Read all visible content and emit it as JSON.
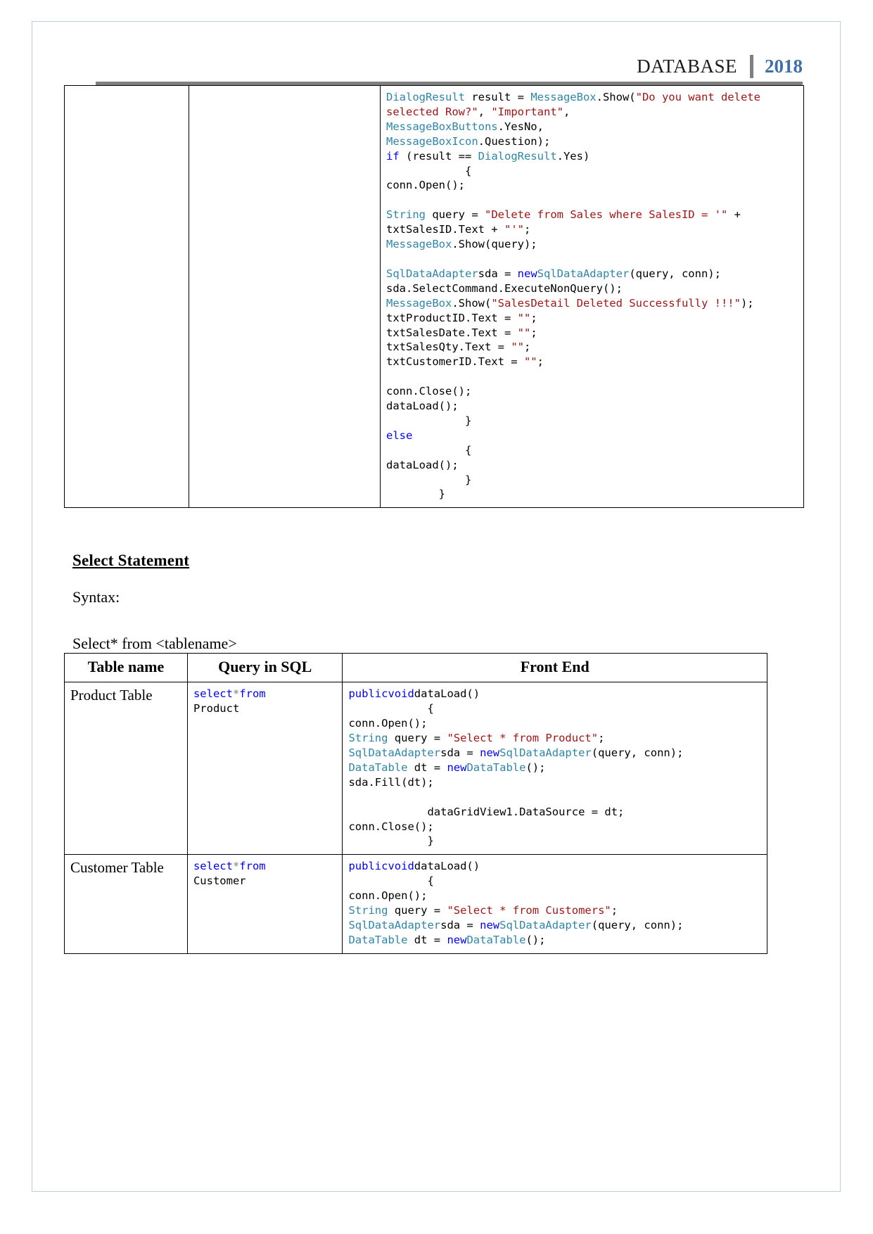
{
  "header": {
    "title": "DATABASE",
    "year": "2018"
  },
  "top_table": {
    "cells": {
      "col1": "",
      "col2": "",
      "code_segments": [
        {
          "t": "DialogResult",
          "c": "type"
        },
        {
          "t": " result = ",
          "c": ""
        },
        {
          "t": "MessageBox",
          "c": "type"
        },
        {
          "t": ".Show(",
          "c": ""
        },
        {
          "t": "\"Do you want delete selected Row?\"",
          "c": "str"
        },
        {
          "t": ", ",
          "c": ""
        },
        {
          "t": "\"Important\"",
          "c": "str"
        },
        {
          "t": ", \n",
          "c": ""
        },
        {
          "t": "MessageBoxButtons",
          "c": "type"
        },
        {
          "t": ".YesNo, \n",
          "c": ""
        },
        {
          "t": "MessageBoxIcon",
          "c": "type"
        },
        {
          "t": ".Question);\n",
          "c": ""
        },
        {
          "t": "if",
          "c": "kw"
        },
        {
          "t": " (result == ",
          "c": ""
        },
        {
          "t": "DialogResult",
          "c": "type"
        },
        {
          "t": ".Yes)\n",
          "c": ""
        },
        {
          "t": "            {\n",
          "c": ""
        },
        {
          "t": "conn.Open();\n\n",
          "c": ""
        },
        {
          "t": "String",
          "c": "type"
        },
        {
          "t": " query = ",
          "c": ""
        },
        {
          "t": "\"Delete from Sales where SalesID = '\"",
          "c": "str"
        },
        {
          "t": " + txtSalesID.Text + ",
          "c": ""
        },
        {
          "t": "\"'\"",
          "c": "str"
        },
        {
          "t": ";\n",
          "c": ""
        },
        {
          "t": "MessageBox",
          "c": "type"
        },
        {
          "t": ".Show(query);\n\n",
          "c": ""
        },
        {
          "t": "SqlDataAdapter",
          "c": "type"
        },
        {
          "t": "sda = ",
          "c": ""
        },
        {
          "t": "new",
          "c": "kw"
        },
        {
          "t": "SqlDataAdapter",
          "c": "type"
        },
        {
          "t": "(query, conn);\n",
          "c": ""
        },
        {
          "t": "sda.SelectCommand.ExecuteNonQuery();\n",
          "c": ""
        },
        {
          "t": "MessageBox",
          "c": "type"
        },
        {
          "t": ".Show(",
          "c": ""
        },
        {
          "t": "\"SalesDetail Deleted Successfully !!!\"",
          "c": "str"
        },
        {
          "t": ");\n",
          "c": ""
        },
        {
          "t": "txtProductID.Text = ",
          "c": ""
        },
        {
          "t": "\"\"",
          "c": "str"
        },
        {
          "t": ";\n",
          "c": ""
        },
        {
          "t": "txtSalesDate.Text = ",
          "c": ""
        },
        {
          "t": "\"\"",
          "c": "str"
        },
        {
          "t": ";\n",
          "c": ""
        },
        {
          "t": "txtSalesQty.Text = ",
          "c": ""
        },
        {
          "t": "\"\"",
          "c": "str"
        },
        {
          "t": ";\n",
          "c": ""
        },
        {
          "t": "txtCustomerID.Text = ",
          "c": ""
        },
        {
          "t": "\"\"",
          "c": "str"
        },
        {
          "t": ";\n\n",
          "c": ""
        },
        {
          "t": "conn.Close();\n",
          "c": ""
        },
        {
          "t": "dataLoad();\n",
          "c": ""
        },
        {
          "t": "            }\n",
          "c": ""
        },
        {
          "t": "else",
          "c": "kw"
        },
        {
          "t": "\n            {\n",
          "c": ""
        },
        {
          "t": "dataLoad();\n",
          "c": ""
        },
        {
          "t": "            }\n",
          "c": ""
        },
        {
          "t": "        }",
          "c": ""
        }
      ]
    }
  },
  "select_section": {
    "heading": "Select Statement",
    "syntax_label": "Syntax:",
    "syntax_text": "Select* from <tablename>"
  },
  "select_table": {
    "headers": [
      "Table name",
      "Query in SQL",
      "Front End"
    ],
    "rows": [
      {
        "table_name": "Product Table",
        "query_segments": [
          {
            "t": "select",
            "c": "kw"
          },
          {
            "t": "*",
            "c": "op"
          },
          {
            "t": "from",
            "c": "kw"
          },
          {
            "t": "\n",
            "c": ""
          },
          {
            "t": "Product",
            "c": ""
          }
        ],
        "frontend_segments": [
          {
            "t": "public",
            "c": "kw"
          },
          {
            "t": "void",
            "c": "kw"
          },
          {
            "t": "dataLoad()\n",
            "c": ""
          },
          {
            "t": "            {\n",
            "c": ""
          },
          {
            "t": "conn.Open();\n",
            "c": ""
          },
          {
            "t": "String",
            "c": "type"
          },
          {
            "t": " query = ",
            "c": ""
          },
          {
            "t": "\"Select * from Product\"",
            "c": "str"
          },
          {
            "t": ";\n",
            "c": ""
          },
          {
            "t": "SqlDataAdapter",
            "c": "type"
          },
          {
            "t": "sda = ",
            "c": ""
          },
          {
            "t": "new",
            "c": "kw"
          },
          {
            "t": "SqlDataAdapter",
            "c": "type"
          },
          {
            "t": "(query, conn);\n",
            "c": ""
          },
          {
            "t": "DataTable",
            "c": "type"
          },
          {
            "t": " dt = ",
            "c": ""
          },
          {
            "t": "new",
            "c": "kw"
          },
          {
            "t": "DataTable",
            "c": "type"
          },
          {
            "t": "();\n",
            "c": ""
          },
          {
            "t": "sda.Fill(dt);\n\n",
            "c": ""
          },
          {
            "t": "            dataGridView1.DataSource = dt;\n",
            "c": ""
          },
          {
            "t": "conn.Close();\n",
            "c": ""
          },
          {
            "t": "            }",
            "c": ""
          }
        ]
      },
      {
        "table_name": "Customer Table",
        "query_segments": [
          {
            "t": "select",
            "c": "kw"
          },
          {
            "t": "*",
            "c": "op"
          },
          {
            "t": "from",
            "c": "kw"
          },
          {
            "t": "\n",
            "c": ""
          },
          {
            "t": "Customer",
            "c": ""
          }
        ],
        "frontend_segments": [
          {
            "t": "public",
            "c": "kw"
          },
          {
            "t": "void",
            "c": "kw"
          },
          {
            "t": "dataLoad()\n",
            "c": ""
          },
          {
            "t": "            {\n",
            "c": ""
          },
          {
            "t": "conn.Open();\n",
            "c": ""
          },
          {
            "t": "String",
            "c": "type"
          },
          {
            "t": " query = ",
            "c": ""
          },
          {
            "t": "\"Select * from Customers\"",
            "c": "str"
          },
          {
            "t": ";\n",
            "c": ""
          },
          {
            "t": "SqlDataAdapter",
            "c": "type"
          },
          {
            "t": "sda = ",
            "c": ""
          },
          {
            "t": "new",
            "c": "kw"
          },
          {
            "t": "SqlDataAdapter",
            "c": "type"
          },
          {
            "t": "(query, conn);\n",
            "c": ""
          },
          {
            "t": "DataTable",
            "c": "type"
          },
          {
            "t": " dt = ",
            "c": ""
          },
          {
            "t": "new",
            "c": "kw"
          },
          {
            "t": "DataTable",
            "c": "type"
          },
          {
            "t": "();",
            "c": ""
          }
        ]
      }
    ]
  },
  "colors": {
    "keyword": "#0000ff",
    "type": "#2e86a8",
    "string": "#a31515",
    "year": "#3f6fa8",
    "rule": "#808080",
    "page_border": "#b9cfe4"
  }
}
